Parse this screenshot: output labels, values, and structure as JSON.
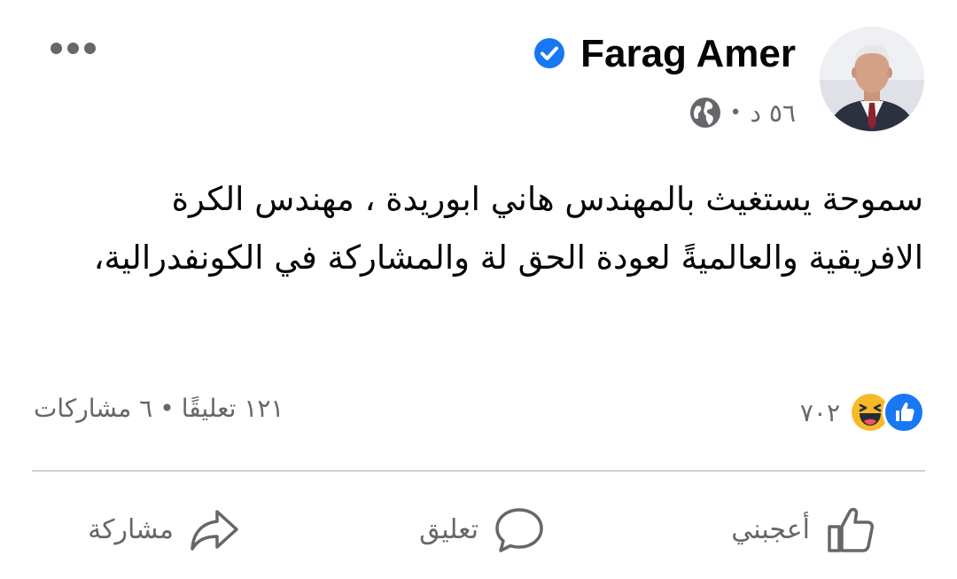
{
  "post": {
    "author": "Farag Amer",
    "time": "٥٦ د",
    "separator": "•",
    "text": "سموحة يستغيث بالمهندس هاني ابوريدة ، مهندس الكرة الافريقية والعالميةً لعودة الحق لة والمشاركة في الكونفدرالية،"
  },
  "icons": {
    "avatar": "profile-photo",
    "verified": "verified-badge-icon",
    "privacy": "globe-icon",
    "more": "more-dots-icon",
    "like_reaction": "like-reaction-icon",
    "haha_reaction": "haha-reaction-icon"
  },
  "stats": {
    "reactions": "٧٠٢",
    "comments": "١٢١ تعليقًا",
    "dot": "•",
    "shares": "٦ مشاركات"
  },
  "actions": {
    "like": "أعجبني",
    "comment": "تعليق",
    "share": "مشاركة"
  },
  "colors": {
    "brand_blue": "#1877f2",
    "secondary_text": "#65676b",
    "haha_yellow": "#f7b928"
  }
}
